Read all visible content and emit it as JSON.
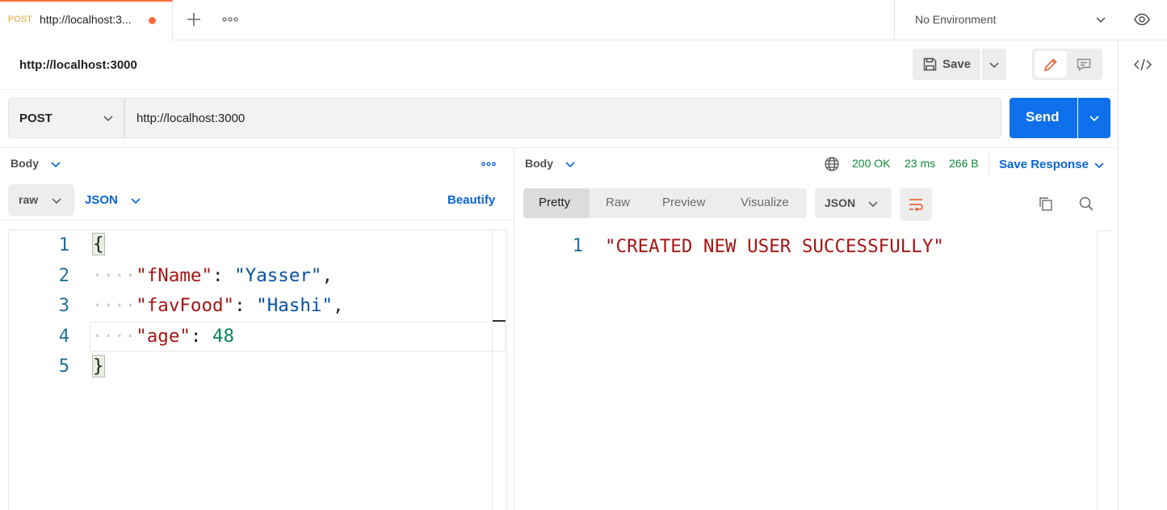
{
  "tab": {
    "method": "POST",
    "title": "http://localhost:3...",
    "method_color": "#e8a33d",
    "unsaved_dot_color": "#ff6c37"
  },
  "environment": {
    "label": "No Environment"
  },
  "request": {
    "title": "http://localhost:3000",
    "save_label": "Save",
    "method": "POST",
    "url": "http://localhost:3000",
    "send_label": "Send",
    "send_color": "#0e71eb"
  },
  "request_body": {
    "section_label": "Body",
    "mode": "raw",
    "format": "JSON",
    "beautify_label": "Beautify",
    "lines": [
      {
        "n": "1",
        "text": "{"
      },
      {
        "n": "2",
        "dots": "····",
        "key": "\"fName\"",
        "colon": ": ",
        "value": "\"Yasser\"",
        "tail": ","
      },
      {
        "n": "3",
        "dots": "····",
        "key": "\"favFood\"",
        "colon": ": ",
        "value": "\"Hashi\"",
        "tail": ","
      },
      {
        "n": "4",
        "dots": "····",
        "key": "\"age\"",
        "colon": ": ",
        "value": "48",
        "tail": ""
      },
      {
        "n": "5",
        "text": "}"
      }
    ]
  },
  "response": {
    "section_label": "Body",
    "status": "200 OK",
    "time": "23 ms",
    "size": "266 B",
    "status_color": "#0b8a36",
    "save_response_label": "Save Response",
    "view_tabs": [
      "Pretty",
      "Raw",
      "Preview",
      "Visualize"
    ],
    "active_view": "Pretty",
    "format": "JSON",
    "lines": [
      {
        "n": "1",
        "text": "\"CREATED NEW USER SUCCESSFULLY\""
      }
    ]
  },
  "icons": [
    "plus-icon",
    "more-icon",
    "chevron-down-icon",
    "eye-icon",
    "save-icon",
    "pencil-icon",
    "comment-icon",
    "code-icon",
    "globe-icon",
    "wrap-lines-icon",
    "copy-icon",
    "search-icon"
  ]
}
